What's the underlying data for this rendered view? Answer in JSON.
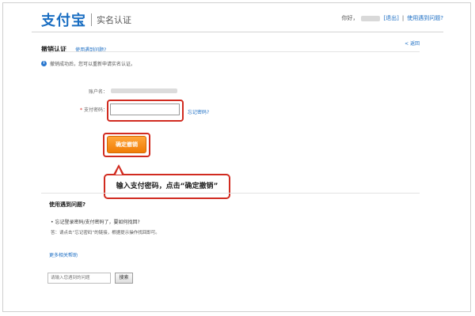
{
  "header": {
    "logo_text": "支付宝",
    "subtitle": "实名认证",
    "greeting": "你好，",
    "logout": "[退出]",
    "divider": "|",
    "help_link": "使用遇到问题?"
  },
  "page": {
    "title": "撤销认证",
    "title_help": "使用遇到问题?",
    "back_link": "< 返回",
    "info_text": "撤销成功后，您可以重新申请实名认证。"
  },
  "form": {
    "account_label": "账户名：",
    "password_label": "支付密码：",
    "required_mark": "*",
    "password_value": "",
    "forgot_link": "忘记密码?",
    "submit_label": "确定撤销"
  },
  "callout": {
    "text": "输入支付密码，点击“确定撤销”"
  },
  "help": {
    "title": "使用遇到问题?",
    "question": "• 忘记登录密码/支付密码了，要如何找回?",
    "answer": "答：请点击“忘记密码”的链接，根据提示操作找回即可。",
    "more_link": "更多相关帮助",
    "search_placeholder": "请输入您遇到的问题",
    "search_button": "搜索"
  },
  "colors": {
    "link": "#1e6fc4",
    "highlight": "#d12b20",
    "button": "#f07d05"
  }
}
